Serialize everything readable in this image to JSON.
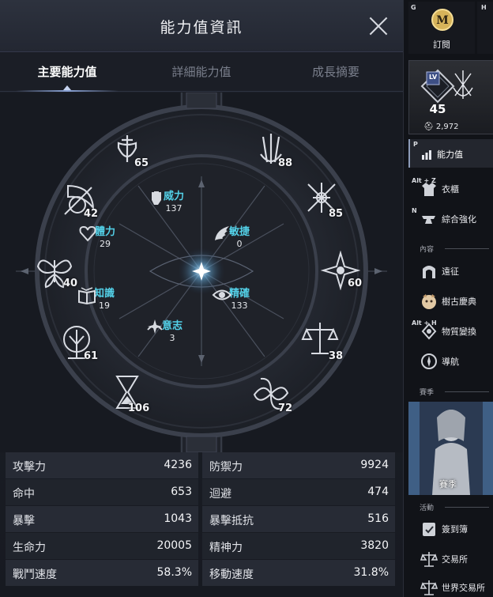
{
  "window": {
    "title": "能力值資訊"
  },
  "tabs": [
    {
      "label": "主要能力值",
      "active": true
    },
    {
      "label": "詳細能力值",
      "active": false
    },
    {
      "label": "成長摘要",
      "active": false
    }
  ],
  "wheel": {
    "outer": [
      {
        "icon": "sword-shield-icon",
        "value": "65"
      },
      {
        "icon": "triple-sword-icon",
        "value": "88"
      },
      {
        "icon": "crossed-blades-icon",
        "value": "85"
      },
      {
        "icon": "star-burst-icon",
        "value": "60"
      },
      {
        "icon": "scales-icon",
        "value": "38"
      },
      {
        "icon": "vortex-icon",
        "value": "72"
      },
      {
        "icon": "hourglass-icon",
        "value": "106"
      },
      {
        "icon": "tree-icon",
        "value": "61"
      },
      {
        "icon": "butterfly-icon",
        "value": "40"
      },
      {
        "icon": "scythe-moon-icon",
        "value": "42"
      }
    ],
    "core": {
      "power": {
        "label": "威力",
        "value": "137",
        "icon": "fist-icon"
      },
      "agility": {
        "label": "敏捷",
        "value": "0",
        "icon": "wing-icon"
      },
      "precision": {
        "label": "精確",
        "value": "133",
        "icon": "eye-icon"
      },
      "will": {
        "label": "意志",
        "value": "3",
        "icon": "spark-icon"
      },
      "knowledge": {
        "label": "知識",
        "value": "19",
        "icon": "book-icon"
      },
      "vitality": {
        "label": "體力",
        "value": "29",
        "icon": "heart-icon"
      }
    },
    "accent_color": "#53d1e8"
  },
  "stats": [
    {
      "left": {
        "label": "攻擊力",
        "value": "4236"
      },
      "right": {
        "label": "防禦力",
        "value": "9924"
      }
    },
    {
      "left": {
        "label": "命中",
        "value": "653"
      },
      "right": {
        "label": "迴避",
        "value": "474"
      }
    },
    {
      "left": {
        "label": "暴擊",
        "value": "1043"
      },
      "right": {
        "label": "暴擊抵抗",
        "value": "516"
      }
    },
    {
      "left": {
        "label": "生命力",
        "value": "20005"
      },
      "right": {
        "label": "精神力",
        "value": "3820"
      }
    },
    {
      "left": {
        "label": "戰鬥速度",
        "value": "58.3%"
      },
      "right": {
        "label": "移動速度",
        "value": "31.8%"
      }
    }
  ],
  "sidebar": {
    "subscribe": {
      "key": "G",
      "label": "訂閱",
      "logo": "M"
    },
    "h_key": "H",
    "level": {
      "badge": "LV",
      "value": "45",
      "power": "2,972"
    },
    "stats_button": {
      "key": "P",
      "label": "能力值"
    },
    "items": [
      {
        "key": "Alt + Z",
        "label": "衣櫃",
        "icon": "wardrobe-icon"
      },
      {
        "key": "N",
        "label": "綜合強化",
        "icon": "anvil-icon"
      }
    ],
    "content_section": {
      "label": "內容"
    },
    "content_items": [
      {
        "key": "",
        "label": "遠征",
        "icon": "gate-icon"
      },
      {
        "key": "",
        "label": "樹古慶典",
        "icon": "mascot-icon"
      },
      {
        "key": "Alt + H",
        "label": "物質變換",
        "icon": "transmute-icon"
      },
      {
        "key": "",
        "label": "導航",
        "icon": "compass-icon"
      }
    ],
    "season_section": {
      "label": "賽季"
    },
    "season": {
      "label": "賽季"
    },
    "activity_section": {
      "label": "活動"
    },
    "activity_items": [
      {
        "key": "",
        "label": "簽到簿",
        "icon": "checkin-icon"
      },
      {
        "key": "",
        "label": "交易所",
        "icon": "scales-icon"
      },
      {
        "key": "",
        "label": "世界交易所",
        "icon": "world-scales-icon"
      }
    ]
  }
}
